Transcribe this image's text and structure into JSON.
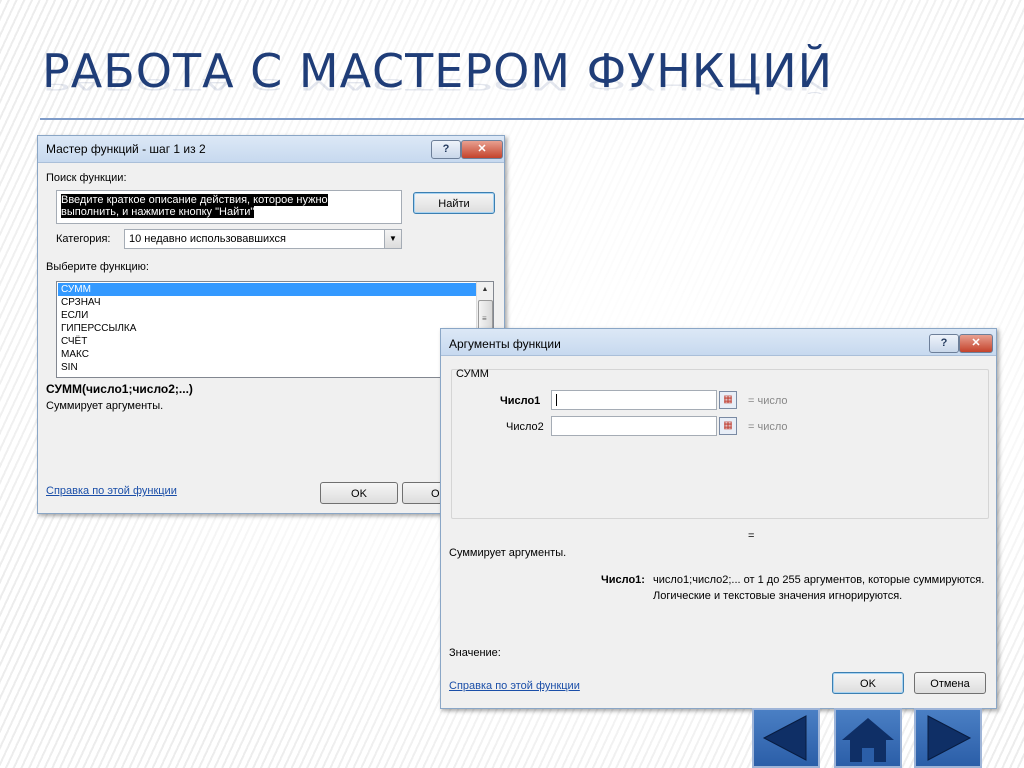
{
  "slide": {
    "title": "Работа с мастером функций"
  },
  "wizard": {
    "title": "Мастер функций - шаг 1 из 2",
    "search_label": "Поиск функции:",
    "search_line1": "Введите краткое описание действия, которое нужно",
    "search_line2": "выполнить, и нажмите кнопку \"Найти\"",
    "find_button": "Найти",
    "category_label": "Категория:",
    "category_value": "10 недавно использовавшихся",
    "select_label": "Выберите функцию:",
    "functions": [
      "СУММ",
      "СРЗНАЧ",
      "ЕСЛИ",
      "ГИПЕРССЫЛКА",
      "СЧЁТ",
      "МАКС",
      "SIN"
    ],
    "selected_index": 0,
    "signature": "СУММ(число1;число2;...)",
    "description": "Суммирует аргументы.",
    "help_link": "Справка по этой функции",
    "ok_button": "OK",
    "cancel_partial": "О"
  },
  "args": {
    "title": "Аргументы функции",
    "function_name": "СУММ",
    "arg1_label": "Число1",
    "arg1_value": "",
    "arg1_result": "= число",
    "arg2_label": "Число2",
    "arg2_value": "",
    "arg2_result": "= число",
    "equals_sign": "=",
    "description": "Суммирует аргументы.",
    "arg_help_label": "Число1:",
    "arg_help_line1": "число1;число2;... от 1 до 255 аргументов, которые суммируются.",
    "arg_help_line2": "Логические и текстовые значения игнорируются.",
    "value_label": "Значение:",
    "help_link": "Справка по этой функции",
    "ok_button": "OK",
    "cancel_button": "Отмена"
  },
  "window_buttons": {
    "help_glyph": "?",
    "close_glyph": "✕"
  },
  "colors": {
    "title": "#1f3d78",
    "selection": "#3399ff",
    "nav": "#2b5ea8"
  }
}
